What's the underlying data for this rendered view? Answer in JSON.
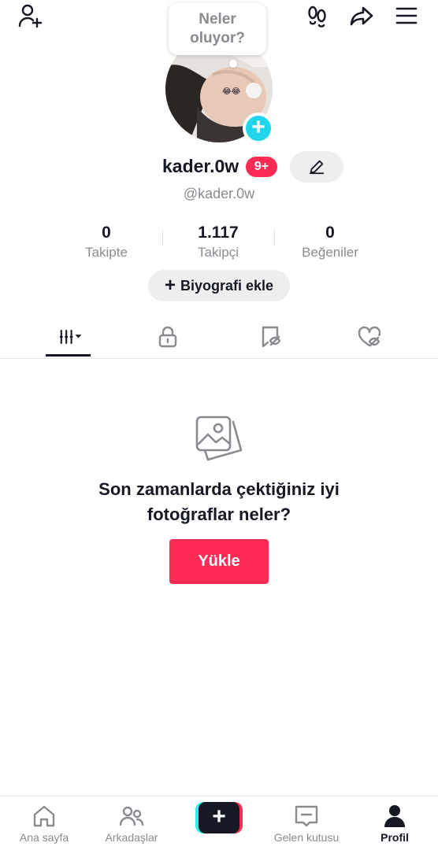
{
  "header": {
    "add_friend_icon": "person-plus-icon",
    "footprints_icon": "footprints-icon",
    "share_icon": "share-arrow-icon",
    "menu_icon": "hamburger-menu-icon"
  },
  "bubble": {
    "text": "Neler oluyor?"
  },
  "profile": {
    "username": "kader.0w",
    "badge": "9+",
    "handle": "@kader.0w",
    "avatar_emoji": "😂😂"
  },
  "stats": [
    {
      "value": "0",
      "label": "Takipte"
    },
    {
      "value": "1.117",
      "label": "Takipçi"
    },
    {
      "value": "0",
      "label": "Beğeniler"
    }
  ],
  "bio_button": {
    "plus": "+",
    "label": "Biyografi ekle"
  },
  "tabs": [
    {
      "name": "videos-grid",
      "icon": "grid-bars-icon",
      "active": true
    },
    {
      "name": "private",
      "icon": "lock-icon",
      "active": false
    },
    {
      "name": "favorites",
      "icon": "bookmark-hidden-icon",
      "active": false
    },
    {
      "name": "liked",
      "icon": "heart-hidden-icon",
      "active": false
    }
  ],
  "empty_state": {
    "icon": "photos-icon",
    "title_line1": "Son zamanlarda çektiğiniz iyi",
    "title_line2": "fotoğraflar neler?",
    "button": "Yükle"
  },
  "bottom_nav": [
    {
      "label": "Ana sayfa",
      "icon": "home-icon"
    },
    {
      "label": "Arkadaşlar",
      "icon": "friends-icon"
    },
    {
      "label": "",
      "icon": "create-plus-icon"
    },
    {
      "label": "Gelen kutusu",
      "icon": "inbox-icon"
    },
    {
      "label": "Profil",
      "icon": "profile-icon",
      "active": true
    }
  ],
  "colors": {
    "accent": "#fe2c55",
    "cyan": "#25f4ee",
    "avatar_plus": "#20d5ec",
    "text": "#161823",
    "muted": "#8a8b91"
  }
}
